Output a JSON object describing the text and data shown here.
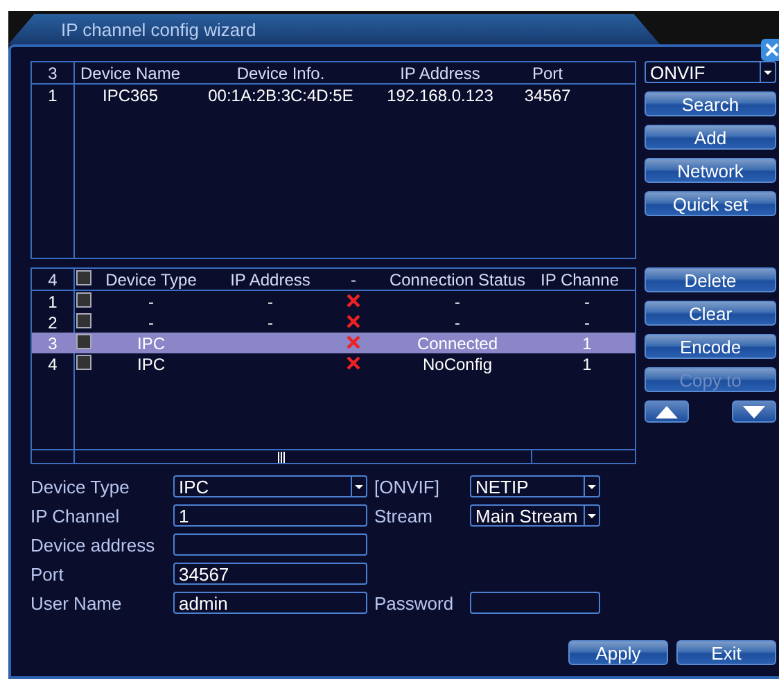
{
  "window": {
    "title": "IP channel config wizard"
  },
  "search_table": {
    "count": "3",
    "columns": [
      "Device Name",
      "Device Info.",
      "IP Address",
      "Port"
    ],
    "rows": [
      {
        "index": "1",
        "name": "IPC365",
        "info": "00:1A:2B:3C:4D:5E",
        "ip": "192.168.0.123",
        "port": "34567"
      }
    ]
  },
  "protocol_select": {
    "value": "ONVIF"
  },
  "search_buttons": [
    {
      "label": "Search",
      "disabled": false
    },
    {
      "label": "Add",
      "disabled": false
    },
    {
      "label": "Network",
      "disabled": false
    },
    {
      "label": "Quick set",
      "disabled": false
    }
  ],
  "channel_table": {
    "count": "4",
    "all_checked": false,
    "columns": [
      "Device Type",
      "IP Address",
      "-",
      "Connection Status",
      "IP Channe"
    ],
    "rows": [
      {
        "index": "1",
        "checked": false,
        "type": "-",
        "ip": "-",
        "connected": false,
        "status": "-",
        "channel": "-",
        "selected": false
      },
      {
        "index": "2",
        "checked": false,
        "type": "-",
        "ip": "-",
        "connected": false,
        "status": "-",
        "channel": "-",
        "selected": false
      },
      {
        "index": "3",
        "checked": false,
        "type": "IPC",
        "connected": false,
        "status": "Connected",
        "channel": "1",
        "selected": true
      },
      {
        "index": "4",
        "checked": false,
        "type": "IPC",
        "connected": false,
        "status": "NoConfig",
        "channel": "1",
        "selected": false
      }
    ]
  },
  "channel_buttons": [
    {
      "label": "Delete",
      "disabled": false
    },
    {
      "label": "Clear",
      "disabled": false
    },
    {
      "label": "Encode",
      "disabled": false
    },
    {
      "label": "Copy to",
      "disabled": true
    }
  ],
  "form": {
    "rows": [
      {
        "left": {
          "label": "Device Type",
          "value": "IPC",
          "kind": "select"
        },
        "right": {
          "label": "[ONVIF]",
          "value": "NETIP",
          "kind": "select"
        }
      },
      {
        "left": {
          "label": "IP Channel",
          "value": "1",
          "kind": "input"
        },
        "right": {
          "label": "Stream",
          "value": "Main Stream",
          "kind": "select"
        }
      },
      {
        "left": {
          "label": "Device address",
          "kind": "input"
        }
      },
      {
        "left": {
          "label": "Port",
          "value": "34567",
          "kind": "input"
        }
      },
      {
        "left": {
          "label": "User Name",
          "value": "admin",
          "kind": "input"
        },
        "right": {
          "label": "Password",
          "kind": "input"
        }
      }
    ]
  },
  "footer_buttons": [
    "Apply",
    "Exit"
  ]
}
